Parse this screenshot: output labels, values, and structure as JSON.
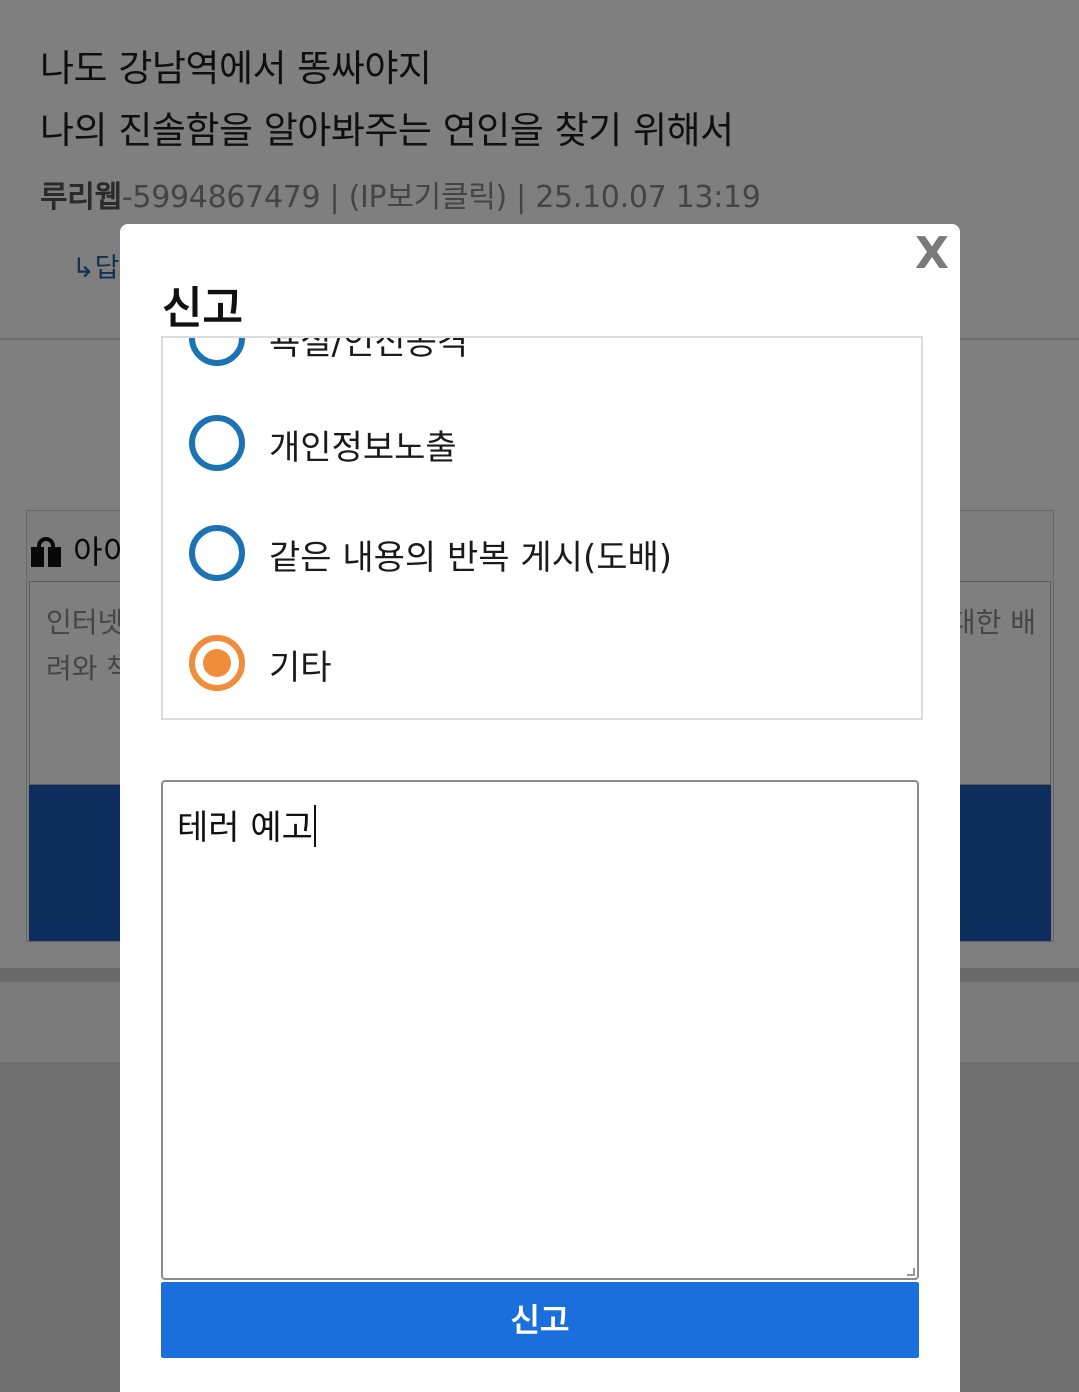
{
  "post": {
    "line1": "나도 강남역에서 똥싸야지",
    "line2": "나의 진솔함을 알아봐주는 연인을 찾기 위해서",
    "author": "루리웹",
    "meta_rest": "-5994867479 | (IP보기클릭) | 25.10.07 13:19",
    "reply_label": "↳답"
  },
  "idea_box": {
    "header": "아이",
    "placeholder_line1": "인터넷",
    "placeholder_line2": "려와 책",
    "placeholder_right": "대한 배"
  },
  "report_modal": {
    "close_label": "X",
    "title": "신고",
    "reasons": [
      {
        "label": "욕설/인신공격",
        "checked": false
      },
      {
        "label": "개인정보노출",
        "checked": false
      },
      {
        "label": "같은 내용의 반복 게시(도배)",
        "checked": false
      },
      {
        "label": "기타",
        "checked": true
      }
    ],
    "detail_value": "테러 예고",
    "submit_label": "신고"
  },
  "colors": {
    "radio_unchecked": "#1b73b3",
    "radio_checked": "#f08c3a",
    "submit_button": "#1b6fdc",
    "overlay": "rgba(0,0,0,0.5)"
  }
}
